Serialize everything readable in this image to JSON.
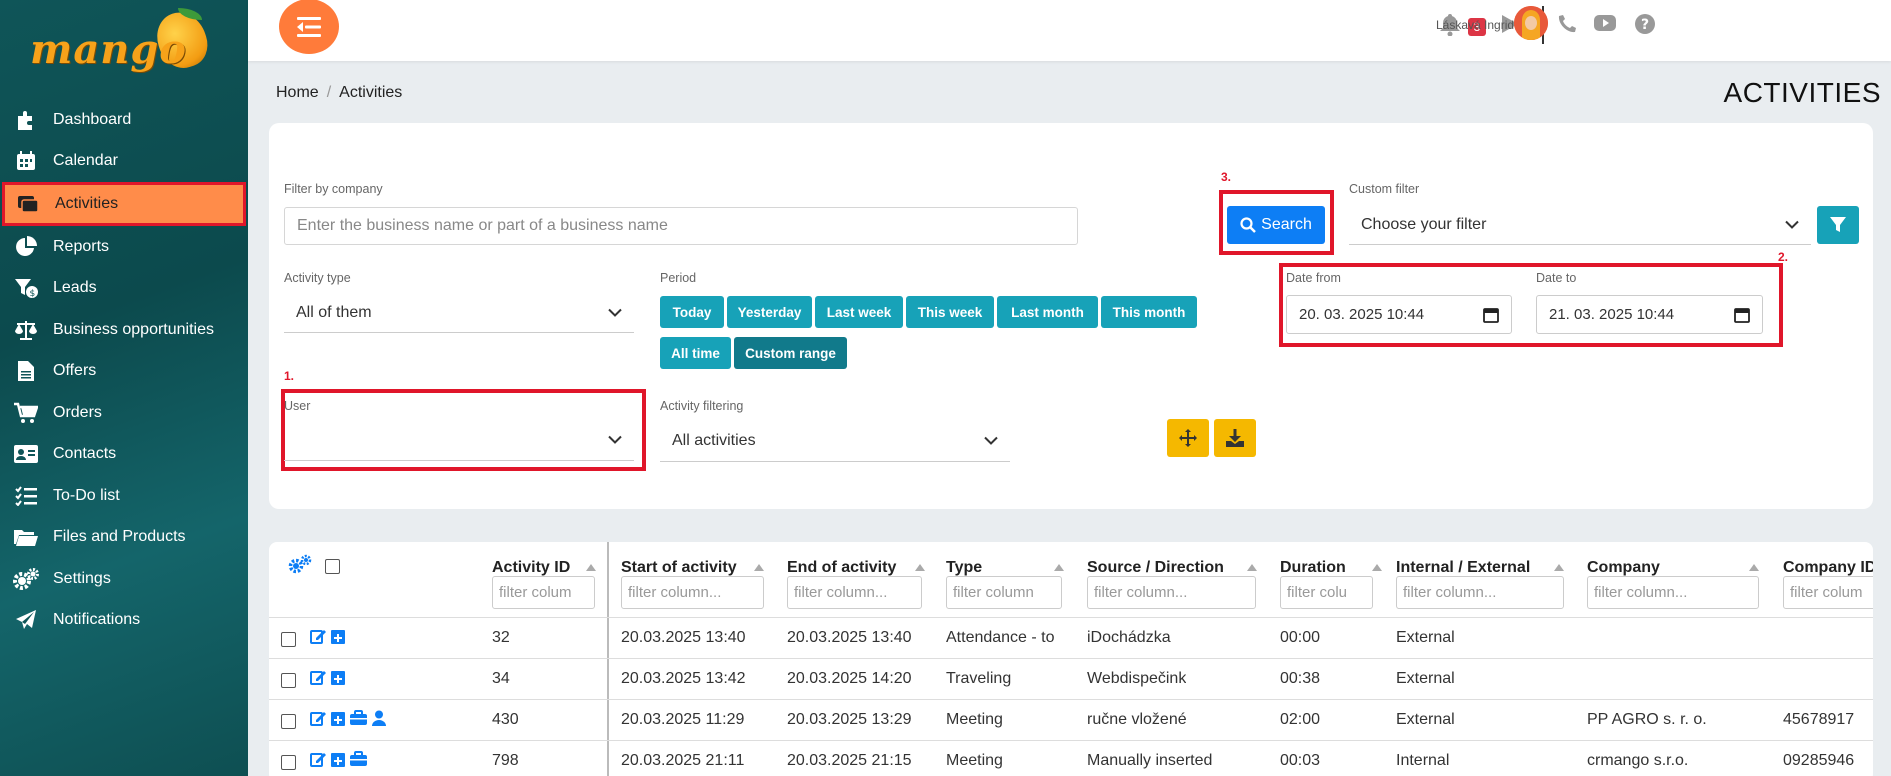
{
  "sidebar": {
    "logo_text": "mango",
    "items": [
      {
        "label": "Dashboard",
        "icon": "puzzle-icon"
      },
      {
        "label": "Calendar",
        "icon": "calendar-icon"
      },
      {
        "label": "Activities",
        "icon": "activities-icon",
        "active": true
      },
      {
        "label": "Reports",
        "icon": "pie-chart-icon"
      },
      {
        "label": "Leads",
        "icon": "funnel-icon"
      },
      {
        "label": "Business opportunities",
        "icon": "scale-icon"
      },
      {
        "label": "Offers",
        "icon": "document-icon"
      },
      {
        "label": "Orders",
        "icon": "cart-icon"
      },
      {
        "label": "Contacts",
        "icon": "contact-card-icon"
      },
      {
        "label": "To-Do list",
        "icon": "checklist-icon"
      },
      {
        "label": "Files and Products",
        "icon": "folder-icon"
      },
      {
        "label": "Settings",
        "icon": "gears-icon"
      },
      {
        "label": "Notifications",
        "icon": "paper-plane-icon"
      }
    ]
  },
  "topbar": {
    "notification_count": "3",
    "user_name": "Láskavá Ingrid"
  },
  "breadcrumb": {
    "home": "Home",
    "current": "Activities"
  },
  "page_title": "ACTIVITIES",
  "filters": {
    "company_label": "Filter by company",
    "company_placeholder": "Enter the business name or part of a business name",
    "search_label": "Search",
    "custom_filter_label": "Custom filter",
    "custom_filter_value": "Choose your filter",
    "activity_type_label": "Activity type",
    "activity_type_value": "All of them",
    "period_label": "Period",
    "period_buttons": [
      "Today",
      "Yesterday",
      "Last week",
      "This week",
      "Last month",
      "This month",
      "All time",
      "Custom range"
    ],
    "date_from_label": "Date from",
    "date_from_value": "20. 03. 2025 10:44",
    "date_to_label": "Date to",
    "date_to_value": "21. 03. 2025 10:44",
    "user_label": "User",
    "user_value": "",
    "activity_filtering_label": "Activity filtering",
    "activity_filtering_value": "All activities",
    "annotations": [
      "1.",
      "2.",
      "3."
    ]
  },
  "table": {
    "columns": [
      "Activity ID",
      "Start of activity",
      "End of activity",
      "Type",
      "Source / Direction",
      "Duration",
      "Internal / External",
      "Company",
      "Company ID"
    ],
    "filter_placeholders": [
      "filter colum",
      "filter column...",
      "filter column...",
      "filter column",
      "filter column...",
      "filter colu",
      "filter column...",
      "filter column...",
      "filter colum"
    ],
    "rows": [
      {
        "id": "32",
        "start": "20.03.2025 13:40",
        "end": "20.03.2025 13:40",
        "type": "Attendance - to",
        "source": "iDochádzka",
        "duration": "00:00",
        "int_ext": "External",
        "company": "",
        "company_id": "",
        "icons": 2
      },
      {
        "id": "34",
        "start": "20.03.2025 13:42",
        "end": "20.03.2025 14:20",
        "type": "Traveling",
        "source": "Webdispečink",
        "duration": "00:38",
        "int_ext": "External",
        "company": "",
        "company_id": "",
        "icons": 2
      },
      {
        "id": "430",
        "start": "20.03.2025 11:29",
        "end": "20.03.2025 13:29",
        "type": "Meeting",
        "source": "ručne vložené",
        "duration": "02:00",
        "int_ext": "External",
        "company": "PP AGRO s. r. o.",
        "company_id": "45678917",
        "icons": 4
      },
      {
        "id": "798",
        "start": "20.03.2025 21:11",
        "end": "20.03.2025 21:15",
        "type": "Meeting",
        "source": "Manually inserted",
        "duration": "00:03",
        "int_ext": "Internal",
        "company": "crmango s.r.o.",
        "company_id": "09285946",
        "icons": 3
      }
    ]
  },
  "colors": {
    "sidebar": "#0f5558",
    "accent_orange": "#ff7b3a",
    "teal": "#17a2b8",
    "primary": "#0d7ef5",
    "highlight_red": "#e0162a",
    "yellow": "#f5b800"
  }
}
